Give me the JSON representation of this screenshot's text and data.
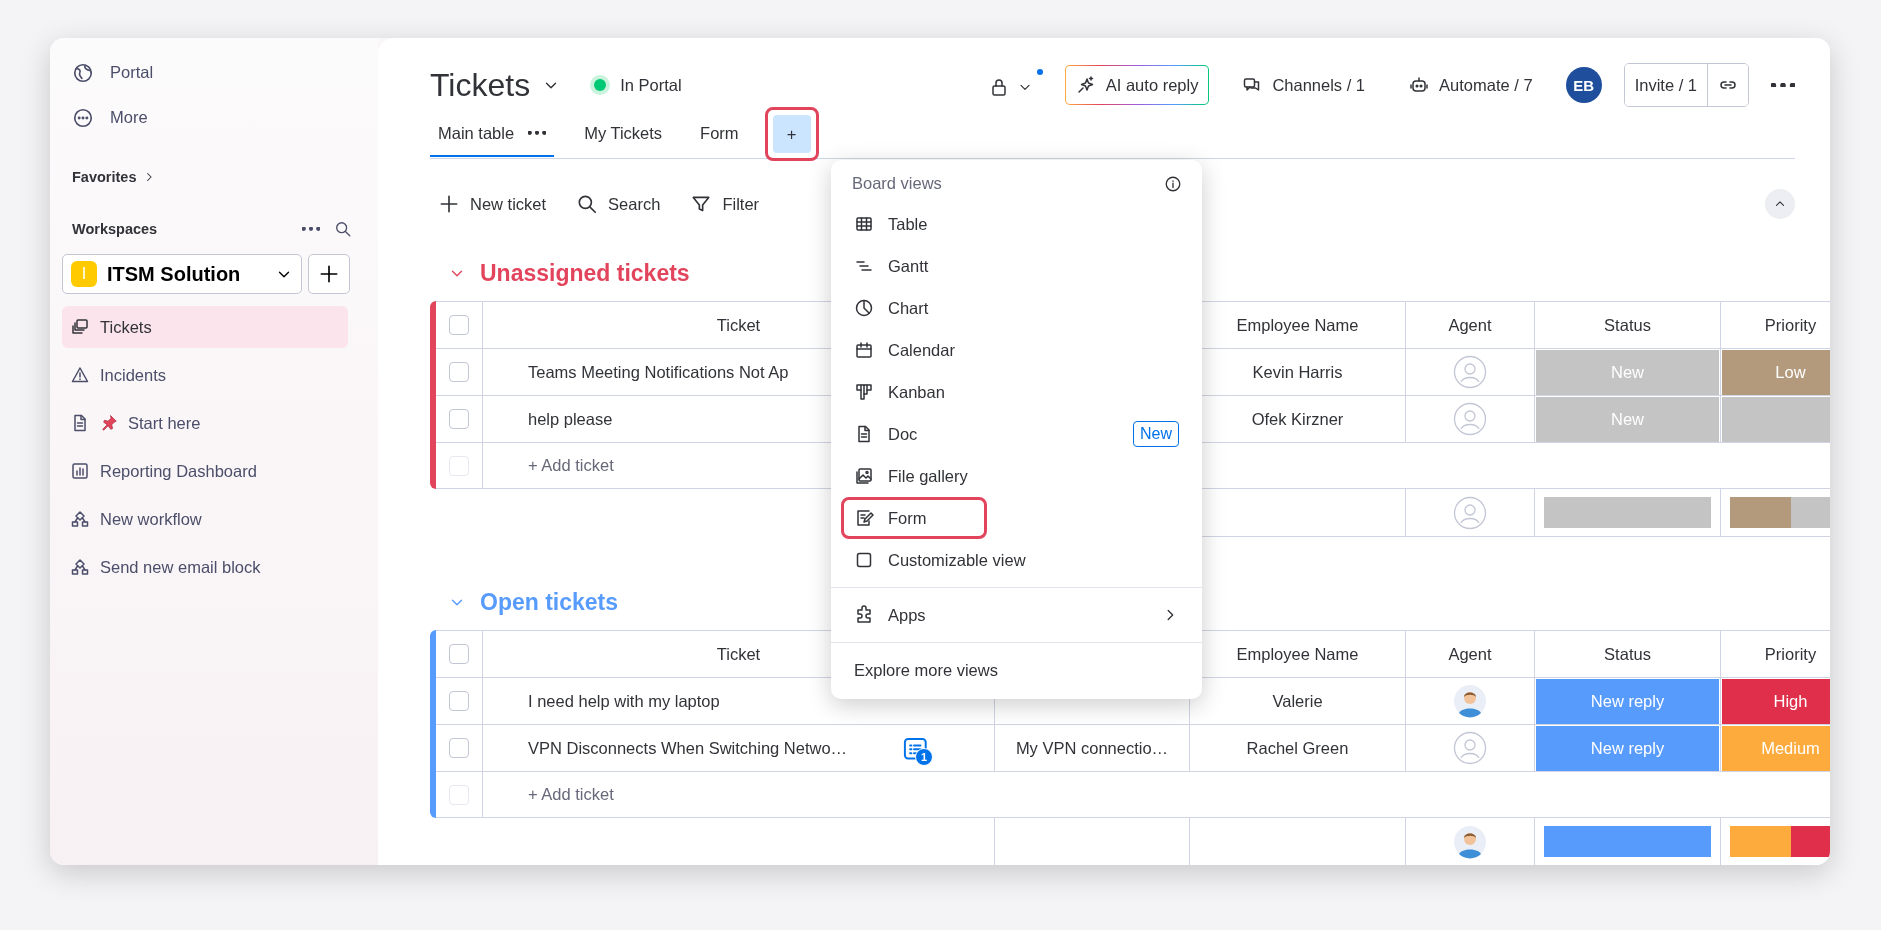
{
  "sidebar": {
    "nav": [
      {
        "kind": "globe",
        "label": "Portal"
      },
      {
        "kind": "more",
        "label": "More"
      }
    ],
    "favorites": "Favorites",
    "workspaces": "Workspaces",
    "workspace": {
      "initial": "I",
      "name": "ITSM Solution"
    },
    "items": [
      {
        "kind": "boards",
        "label": "Tickets",
        "selected": true
      },
      {
        "kind": "warning",
        "label": "Incidents",
        "selected": false
      },
      {
        "kind": "doc-pin",
        "label": "Start here",
        "selected": false
      },
      {
        "kind": "dashboard",
        "label": "Reporting Dashboard",
        "selected": false
      },
      {
        "kind": "workflow",
        "label": "New workflow",
        "selected": false
      },
      {
        "kind": "workflow",
        "label": "Send new email block",
        "selected": false
      }
    ]
  },
  "board": {
    "title": "Tickets",
    "portal": {
      "label": "In Portal",
      "on": true
    },
    "actions": [
      {
        "kind": "lock",
        "notification": true
      },
      {
        "kind": "ai",
        "label": "AI auto reply"
      },
      {
        "kind": "channels",
        "label": "Channels / 1"
      },
      {
        "kind": "automate",
        "label": "Automate / 7"
      },
      {
        "kind": "avatar",
        "label": "EB"
      },
      {
        "kind": "invite",
        "label": "Invite / 1"
      },
      {
        "kind": "more"
      }
    ],
    "tabs": [
      {
        "label": "Main table",
        "selected": true,
        "has_menu": true
      },
      {
        "label": "My Tickets",
        "selected": false,
        "has_menu": false
      },
      {
        "label": "Form",
        "selected": false,
        "has_menu": false
      }
    ],
    "add_view": {
      "label": "+",
      "selected": true,
      "highlighted": true
    },
    "toolbar": [
      {
        "kind": "plus",
        "label": "New ticket"
      },
      {
        "kind": "search",
        "label": "Search"
      },
      {
        "kind": "filter",
        "label": "Filter"
      }
    ],
    "groups": [
      {
        "title": "Unassigned tickets",
        "color": "#e2445c",
        "expanded": true,
        "columns": [
          {
            "kind": "check"
          },
          {
            "kind": "ticket",
            "label": "Ticket"
          },
          {
            "kind": "text"
          },
          {
            "kind": "person",
            "label": "Employee Name"
          },
          {
            "kind": "agent",
            "label": "Agent"
          },
          {
            "kind": "status",
            "label": "Status"
          },
          {
            "kind": "status",
            "label": "Priority"
          }
        ],
        "all_checked": false,
        "rows": [
          {
            "ticket": "Teams Meeting Notifications Not Ap",
            "checked": false,
            "employee": "Kevin Harris",
            "agent_assigned": false,
            "status": {
              "label": "New",
              "color": "#c4c4c4"
            },
            "priority": {
              "label": "Low",
              "color": "#b49a7d"
            }
          },
          {
            "ticket": "help please",
            "checked": false,
            "employee": "Ofek Kirzner",
            "agent_assigned": false,
            "status": {
              "label": "New",
              "color": "#c4c4c4"
            },
            "priority": {
              "color": "#c4c4c4"
            }
          }
        ],
        "add_row": "+ Add ticket",
        "summary": {
          "agent_assigned": false,
          "status": [
            {
              "color": "#c4c4c4"
            }
          ],
          "priority": [
            {
              "color": "#b49a7d"
            },
            {
              "color": "#c4c4c4"
            }
          ]
        }
      },
      {
        "title": "Open tickets",
        "color": "#579bfc",
        "expanded": true,
        "columns": [
          {
            "kind": "check"
          },
          {
            "kind": "ticket",
            "label": "Ticket"
          },
          {
            "kind": "text"
          },
          {
            "kind": "person",
            "label": "Employee Name"
          },
          {
            "kind": "agent",
            "label": "Agent"
          },
          {
            "kind": "status",
            "label": "Status"
          },
          {
            "kind": "status",
            "label": "Priority"
          }
        ],
        "all_checked": false,
        "rows": [
          {
            "ticket": "I need help with my laptop",
            "checked": false,
            "employee": "Valerie",
            "agent_assigned": true,
            "status": {
              "label": "New reply",
              "color": "#579bfc"
            },
            "priority": {
              "label": "High",
              "color": "#df2f4a"
            }
          },
          {
            "ticket": "VPN Disconnects When Switching Netwo…",
            "checked": false,
            "updates": "1",
            "column_3": "My VPN connectio…",
            "employee": "Rachel Green",
            "agent_assigned": false,
            "status": {
              "label": "New reply",
              "color": "#579bfc"
            },
            "priority": {
              "label": "Medium",
              "color": "#fdab3d"
            }
          }
        ],
        "add_row": "+ Add ticket",
        "summary": {
          "agent_assigned": true,
          "status": [
            {
              "color": "#579bfc"
            }
          ],
          "priority": [
            {
              "color": "#fdab3d"
            },
            {
              "color": "#df2f4a"
            }
          ]
        }
      }
    ]
  },
  "menu": {
    "title": "Board views",
    "sections": [
      {
        "items": [
          {
            "kind": "table",
            "label": "Table",
            "highlighted": false
          },
          {
            "kind": "gantt",
            "label": "Gantt",
            "highlighted": false
          },
          {
            "kind": "chart",
            "label": "Chart",
            "highlighted": false
          },
          {
            "kind": "calendar",
            "label": "Calendar",
            "highlighted": false
          },
          {
            "kind": "kanban",
            "label": "Kanban",
            "highlighted": false
          },
          {
            "kind": "doc",
            "label": "Doc",
            "badge": "New",
            "highlighted": false
          },
          {
            "kind": "gallery",
            "label": "File gallery",
            "highlighted": false
          },
          {
            "kind": "form",
            "label": "Form",
            "highlighted": true
          },
          {
            "kind": "square",
            "label": "Customizable view",
            "highlighted": false
          }
        ]
      },
      {
        "items": [
          {
            "kind": "apps",
            "label": "Apps",
            "submenu": true,
            "highlighted": false
          }
        ]
      },
      {
        "items": [
          {
            "kind": "none",
            "label": "Explore more views",
            "highlighted": false
          }
        ]
      }
    ]
  }
}
